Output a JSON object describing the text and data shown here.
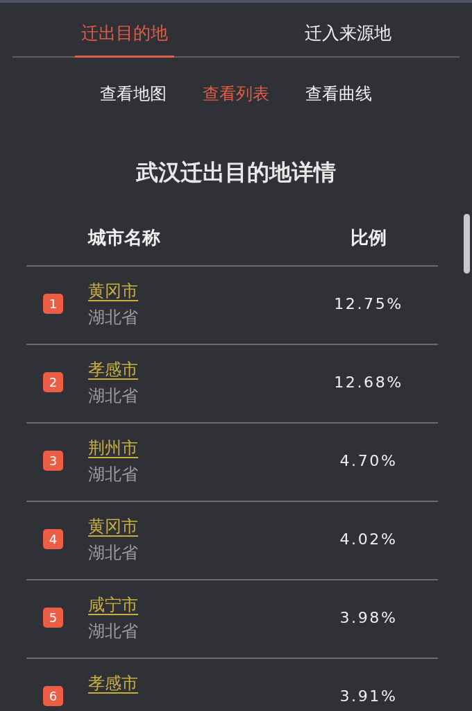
{
  "tabs": [
    {
      "label": "迁出目的地",
      "selected": true
    },
    {
      "label": "迁入来源地",
      "selected": false
    }
  ],
  "view_tabs": [
    {
      "label": "查看地图",
      "selected": false
    },
    {
      "label": "查看列表",
      "selected": true
    },
    {
      "label": "查看曲线",
      "selected": false
    }
  ],
  "title": "武汉迁出目的地详情",
  "table": {
    "columns": [
      "城市名称",
      "比例"
    ],
    "rows": [
      {
        "rank": "1",
        "city": "黄冈市",
        "province": "湖北省",
        "ratio": "12.75%"
      },
      {
        "rank": "2",
        "city": "孝感市",
        "province": "湖北省",
        "ratio": "12.68%"
      },
      {
        "rank": "3",
        "city": "荆州市",
        "province": "湖北省",
        "ratio": "4.70%"
      },
      {
        "rank": "4",
        "city": "黄冈市",
        "province": "湖北省",
        "ratio": "4.02%"
      },
      {
        "rank": "5",
        "city": "咸宁市",
        "province": "湖北省",
        "ratio": "3.98%"
      },
      {
        "rank": "6",
        "city": "孝感市",
        "ratio": "3.91%"
      }
    ]
  }
}
